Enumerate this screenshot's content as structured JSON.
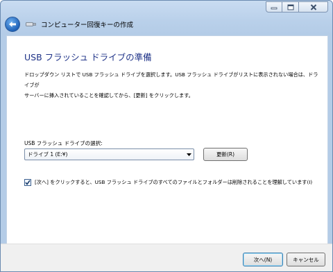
{
  "window": {
    "title": "コンピューター回復キーの作成"
  },
  "page": {
    "heading": "USB フラッシュ ドライブの準備",
    "description_line1": "ドロップダウン リストで USB フラッシュ ドライブを選択します。USB フラッシュ ドライブがリストに表示されない場合は、ドライブが",
    "description_line2": "サーバーに挿入されていることを確認してから、[更新] をクリックします。"
  },
  "drive_select": {
    "label": "USB フラッシュ ドライブの選択:",
    "value": "ドライブ 1 (E:¥)"
  },
  "refresh_button": {
    "label": "更新(R)"
  },
  "confirm_checkbox": {
    "checked": true,
    "label": "[次へ] をクリックすると、USB フラッシュ ドライブのすべてのファイルとフォルダーは削除されることを理解しています(I)"
  },
  "footer": {
    "next_label": "次へ(N)",
    "cancel_label": "キャンセル"
  },
  "icons": {
    "back": "back-arrow-icon",
    "usb": "usb-drive-icon",
    "minimize": "minimize-icon",
    "maximize": "maximize-icon",
    "close": "close-icon",
    "dropdown": "chevron-down-icon",
    "check": "checkmark-icon"
  },
  "colors": {
    "heading": "#1e3287",
    "title_bar": "#b9d0ea",
    "back_button": "#1f62b8"
  }
}
